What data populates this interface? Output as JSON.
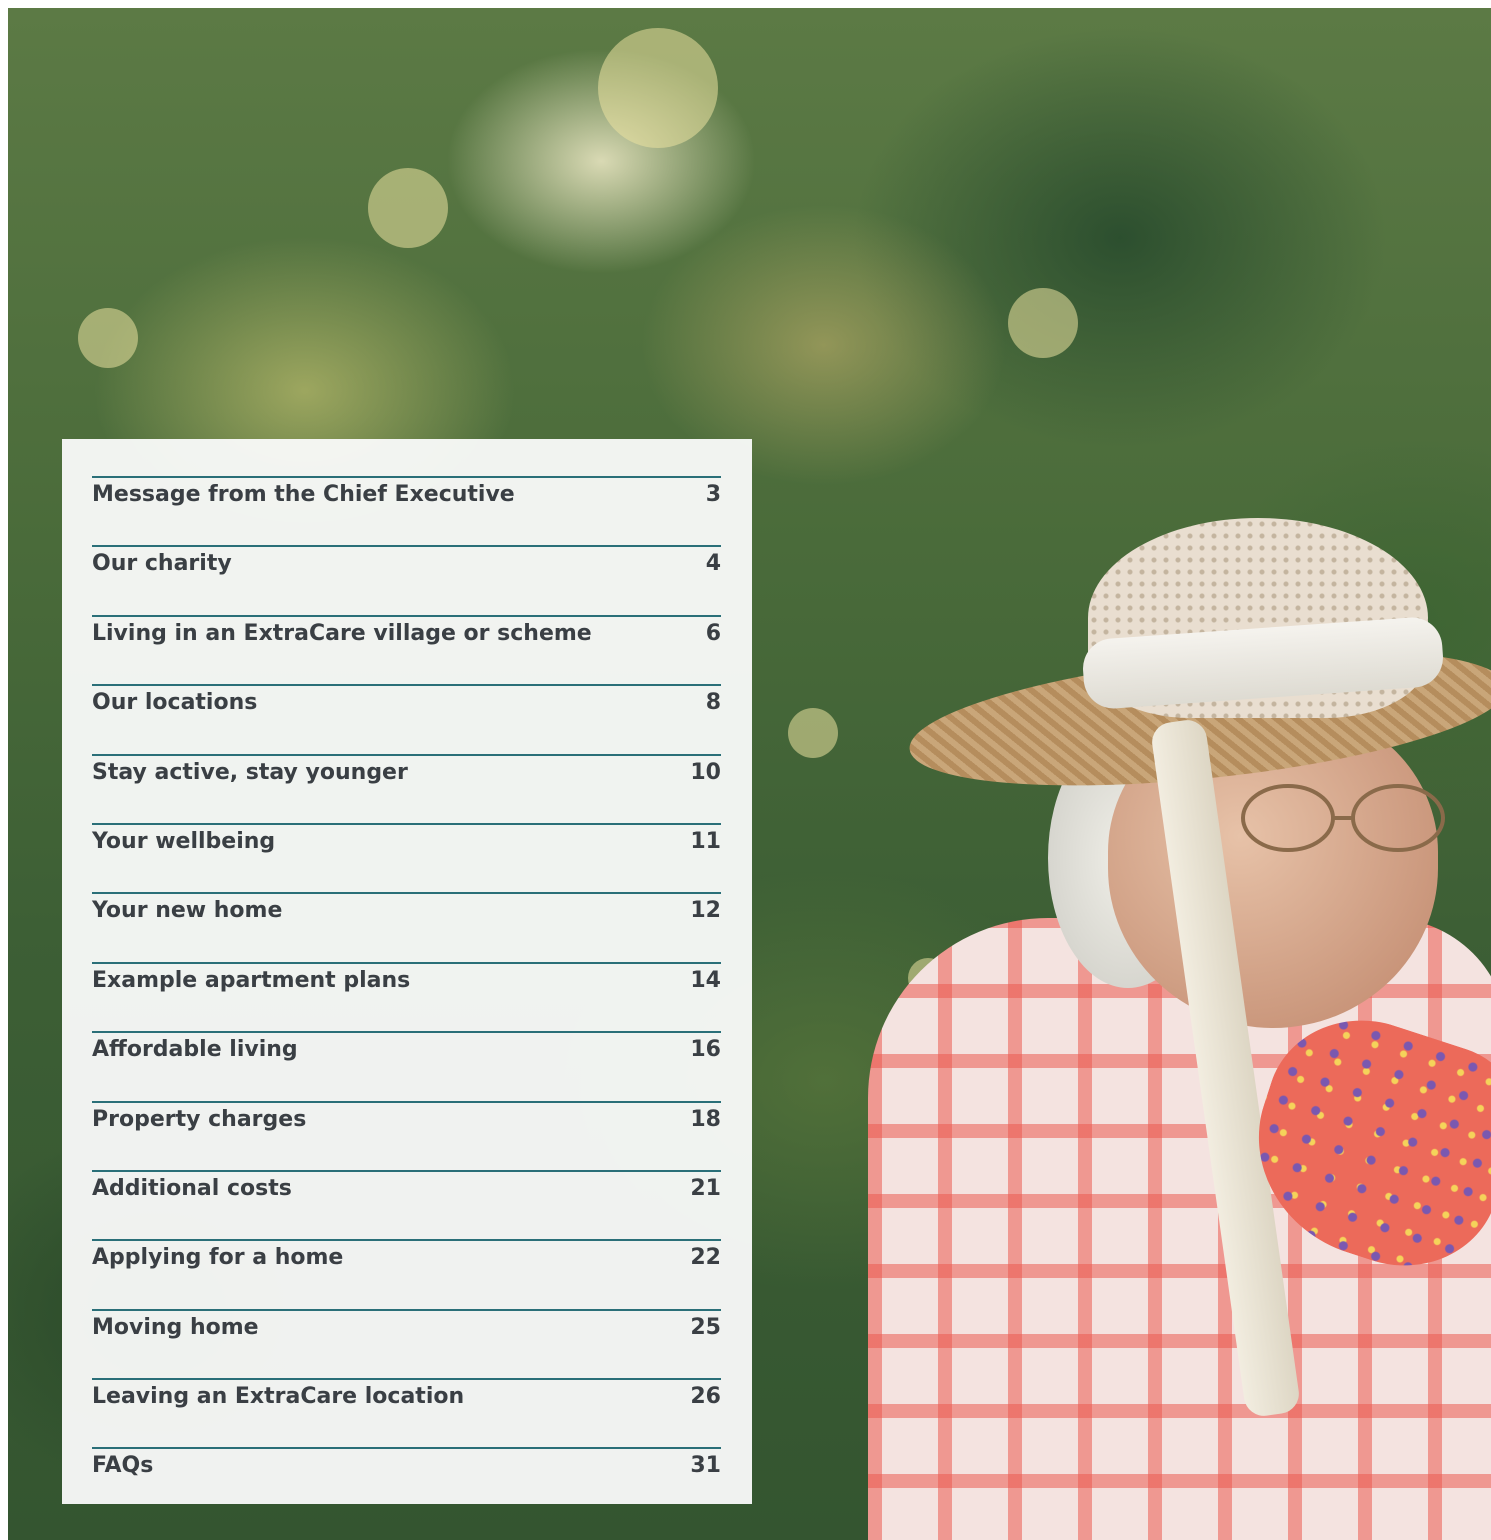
{
  "contents": {
    "entries": [
      {
        "title": "Message from the Chief Executive",
        "page": "3"
      },
      {
        "title": "Our charity",
        "page": "4"
      },
      {
        "title": "Living in an ExtraCare village or scheme",
        "page": "6"
      },
      {
        "title": "Our locations",
        "page": "8"
      },
      {
        "title": "Stay active, stay younger",
        "page": "10"
      },
      {
        "title": "Your wellbeing",
        "page": "11"
      },
      {
        "title": "Your new home",
        "page": "12"
      },
      {
        "title": "Example apartment plans",
        "page": "14"
      },
      {
        "title": "Affordable living",
        "page": "16"
      },
      {
        "title": "Property charges",
        "page": "18"
      },
      {
        "title": "Additional costs",
        "page": "21"
      },
      {
        "title": "Applying for a home",
        "page": "22"
      },
      {
        "title": "Moving home",
        "page": "25"
      },
      {
        "title": "Leaving an ExtraCare location",
        "page": "26"
      },
      {
        "title": "FAQs",
        "page": "31"
      }
    ]
  },
  "colors": {
    "divider": "#2a6f78",
    "text": "#3a3f44",
    "panel": "#f8f9f8"
  }
}
